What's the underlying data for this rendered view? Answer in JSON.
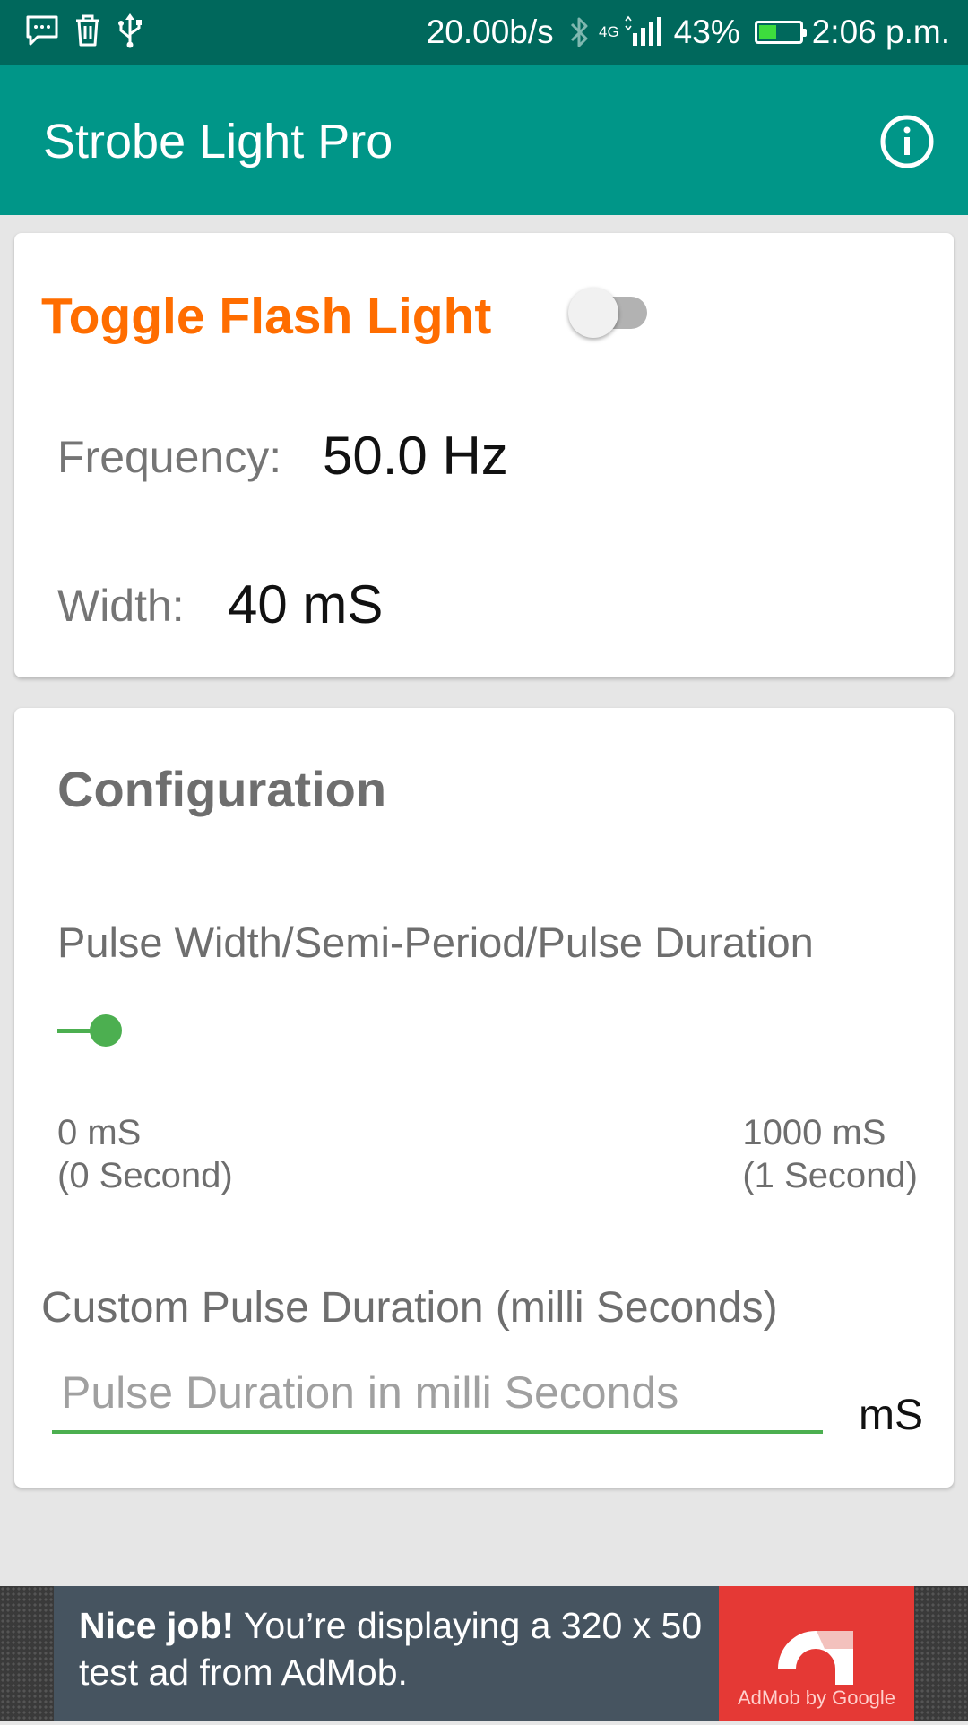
{
  "status_bar": {
    "network_speed": "20.00b/s",
    "network_type": "4G",
    "battery_percent": "43%",
    "battery_level": 0.43,
    "time": "2:06 p.m.",
    "left_icons": [
      "message-icon",
      "trash-icon",
      "usb-icon"
    ],
    "right_icons": [
      "bluetooth-icon",
      "signal-icon",
      "battery-icon"
    ]
  },
  "app_bar": {
    "title": "Strobe Light Pro",
    "info_icon": "info-icon",
    "color": "#009688",
    "status_color": "#00685c"
  },
  "flash_card": {
    "toggle_label": "Toggle Flash Light",
    "toggle_on": false,
    "frequency_label": "Frequency:",
    "frequency_value": "50.0 Hz",
    "width_label": "Width:",
    "width_value": "40 mS",
    "accent_color": "#ff6d00"
  },
  "config_card": {
    "title": "Configuration",
    "pulse_label": "Pulse Width/Semi-Period/Pulse Duration",
    "slider_value_ms": 40,
    "slider_min_ms": 0,
    "slider_max_ms": 1000,
    "min_label": "0 mS",
    "min_sub": "(0 Second)",
    "max_label": "1000 mS",
    "max_sub": "(1 Second)",
    "custom_label": "Custom Pulse Duration (milli Seconds)",
    "input_value": "",
    "input_placeholder": "Pulse Duration in milli Seconds",
    "unit": "mS",
    "accent_color": "#4caf50"
  },
  "ad": {
    "headline": "Nice job!",
    "body": "You’re displaying a 320 x 50 test ad from AdMob.",
    "logo_caption": "AdMob by Google"
  }
}
